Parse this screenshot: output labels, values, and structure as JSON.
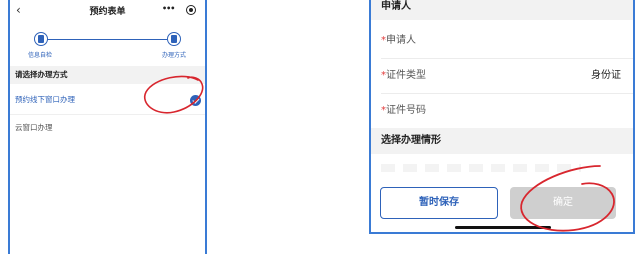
{
  "left_screen": {
    "nav": {
      "back_icon": "chevron-left-icon",
      "title": "预约表单",
      "more_label": "•••",
      "target_icon": "target-icon"
    },
    "steps": [
      {
        "label": "信息自检",
        "icon": "document-icon"
      },
      {
        "label": "办理方式",
        "icon": "document-icon"
      }
    ],
    "section_title": "请选择办理方式",
    "options": [
      {
        "label": "预约线下窗口办理",
        "selected": true
      },
      {
        "label": "云窗口办理",
        "selected": false
      }
    ]
  },
  "right_screen": {
    "applicant_header": "申请人",
    "required_mark": "*",
    "fields": [
      {
        "label": "申请人",
        "value": ""
      },
      {
        "label": "证件类型",
        "value": "身份证"
      },
      {
        "label": "证件号码",
        "value": ""
      }
    ],
    "situation_header": "选择办理情形",
    "buttons": {
      "save": "暂时保存",
      "confirm": "确定"
    }
  },
  "colors": {
    "accent": "#2e62b9",
    "frame": "#3a7bd5",
    "annotation": "#d8262e",
    "disabled_button": "#cfcfcf",
    "required": "#e23b3b"
  }
}
